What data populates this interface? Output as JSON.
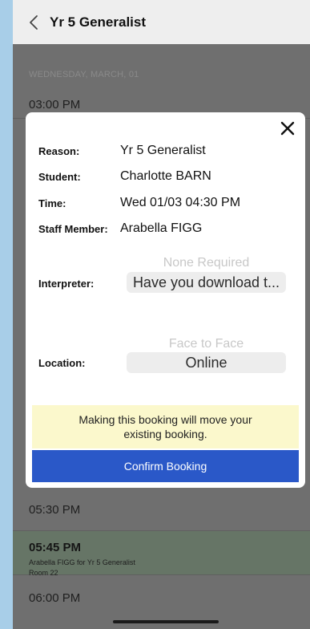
{
  "header": {
    "title": "Yr 5 Generalist"
  },
  "schedule": {
    "date": "WEDNESDAY, MARCH, 01",
    "slots": {
      "t0300": "03:00 PM",
      "t0530": "05:30 PM",
      "t0545": "05:45 PM",
      "t0545_detail": "Arabella FIGG for Yr 5 Generalist",
      "t0545_room": "Room 22",
      "t0600": "06:00 PM"
    }
  },
  "modal": {
    "reason_label": "Reason:",
    "reason_value": "Yr 5 Generalist",
    "student_label": "Student:",
    "student_value": "Charlotte BARN",
    "time_label": "Time:",
    "time_value": "Wed 01/03 04:30 PM",
    "staff_label": "Staff Member:",
    "staff_value": "Arabella FIGG",
    "interpreter_label": "Interpreter:",
    "interpreter_option_above": "None Required",
    "interpreter_selected": "Have you download t...",
    "location_label": "Location:",
    "location_option_above": "Face to Face",
    "location_selected": "Online",
    "notice_line1": "Making this booking will move your",
    "notice_line2": "existing booking.",
    "confirm_label": "Confirm Booking"
  },
  "icons": {
    "back": "chevron-left-icon",
    "close": "close-icon"
  },
  "colors": {
    "primary_button": "#2a58c8",
    "notice_bg": "#fbf8cc",
    "booked_slot": "#667566"
  }
}
